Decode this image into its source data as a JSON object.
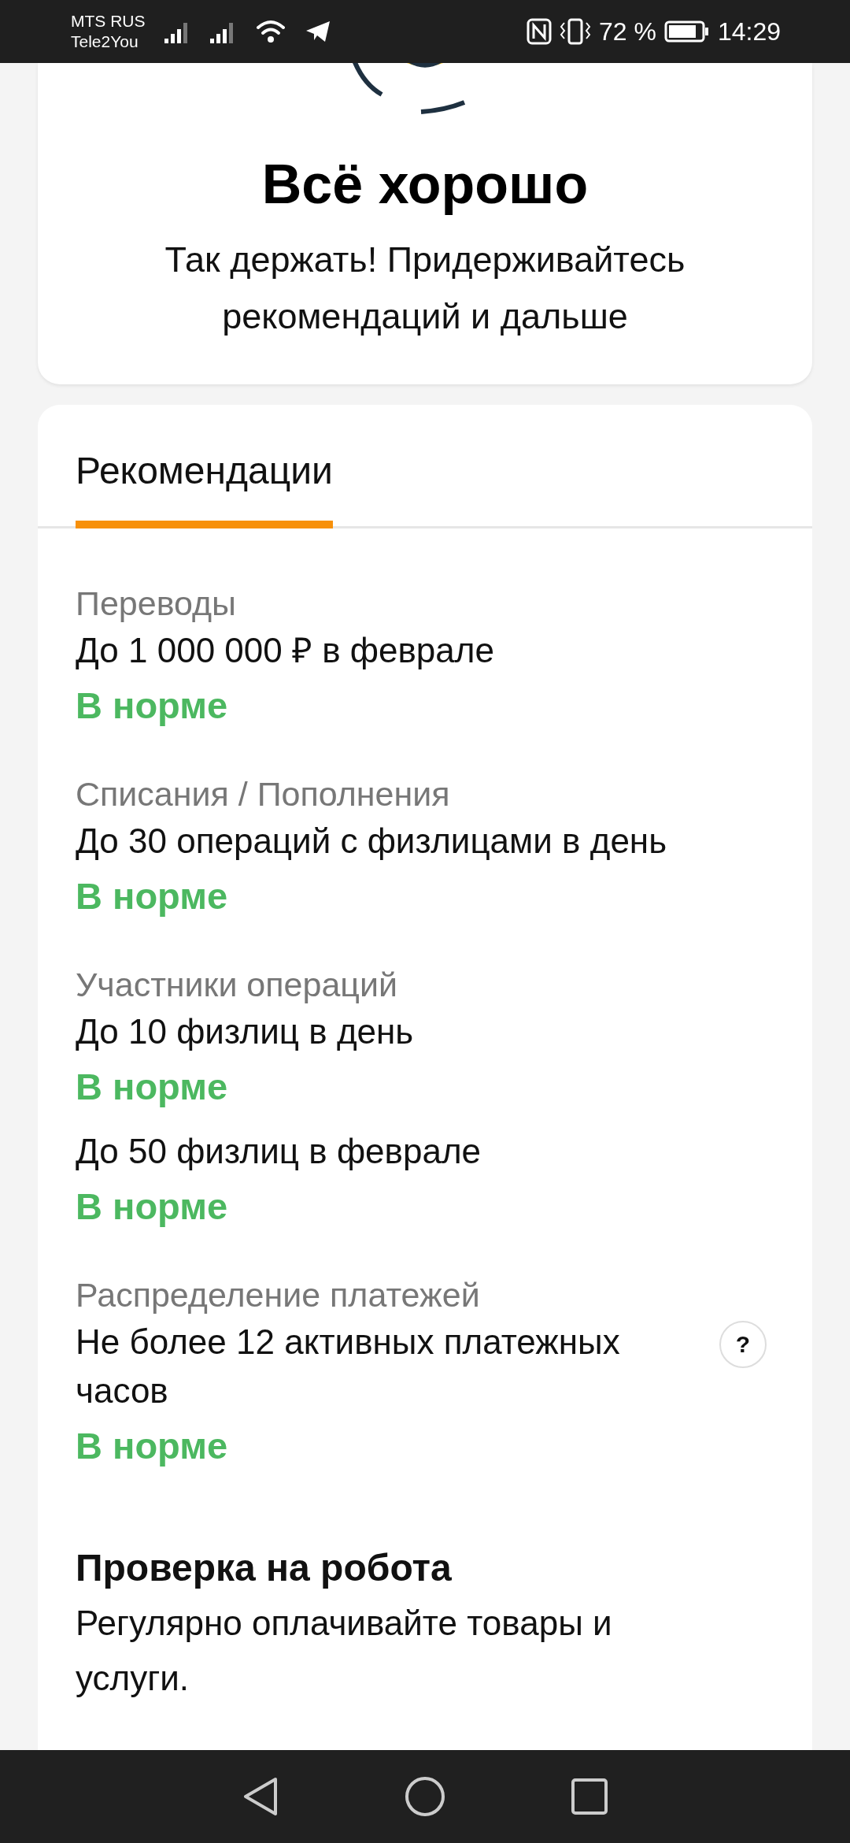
{
  "status_bar": {
    "carriers": [
      "MTS RUS",
      "Tele2You"
    ],
    "battery": "72 %",
    "time": "14:29"
  },
  "summary": {
    "title": "Всё хорошо",
    "text": "Так держать! Придерживайтесь рекомендаций и дальше"
  },
  "tabs": [
    {
      "label": "Рекомендации",
      "selected": true
    }
  ],
  "groups": [
    {
      "category": "Переводы",
      "rules": [
        {
          "text": "До 1 000 000 ₽ в феврале",
          "status": "В норме",
          "help": false
        }
      ]
    },
    {
      "category": "Списания / Пополнения",
      "rules": [
        {
          "text": "До 30 операций с физлицами в день",
          "status": "В норме",
          "help": false
        }
      ]
    },
    {
      "category": "Участники операций",
      "rules": [
        {
          "text": "До 10 физлиц в день",
          "status": "В норме",
          "help": false
        },
        {
          "text": "До 50 физлиц в феврале",
          "status": "В норме",
          "help": false
        }
      ]
    },
    {
      "category": "Распределение платежей",
      "rules": [
        {
          "text": "Не более 12 активных платежных часов",
          "status": "В норме",
          "help": true,
          "help_label": "?"
        }
      ]
    }
  ],
  "robot_check": {
    "title": "Проверка на робота",
    "text": "Регулярно оплачивайте товары и услуги."
  }
}
